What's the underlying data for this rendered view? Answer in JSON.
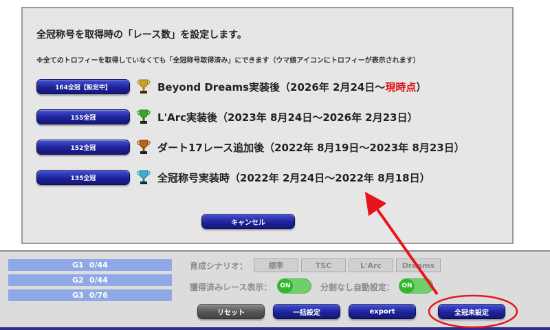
{
  "dialog": {
    "title": "全冠称号を取得時の「レース数」を設定します。",
    "note": "※全てのトロフィーを取得していなくても「全冠称号取得済み」にできます（ウマ娘アイコンにトロフィーが表示されます）",
    "options": [
      {
        "button": "164全冠【設定中】",
        "label": "Beyond Dreams実装後（2026年 2月24日～",
        "label_highlight": "現時点",
        "label_end": "）",
        "trophy_color": "#c9a227"
      },
      {
        "button": "155全冠",
        "label": "L'Arc実装後（2023年 8月24日～2026年 2月23日）",
        "label_highlight": "",
        "label_end": "",
        "trophy_color": "#3aa52e"
      },
      {
        "button": "152全冠",
        "label": "ダート17レース追加後（2022年 8月19日～2023年 8月23日）",
        "label_highlight": "",
        "label_end": "",
        "trophy_color": "#b5651d"
      },
      {
        "button": "135全冠",
        "label": "全冠称号実装時（2022年 2月24日～2022年 8月18日）",
        "label_highlight": "",
        "label_end": "",
        "trophy_color": "#35b3c9"
      }
    ],
    "cancel": "キャンセル"
  },
  "panel": {
    "grades": [
      {
        "name": "G1",
        "value": "0/44"
      },
      {
        "name": "G2",
        "value": "0/44"
      },
      {
        "name": "G3",
        "value": "0/76"
      }
    ],
    "scenario_label": "育成シナリオ：",
    "scenarios": [
      "標準",
      "TSC",
      "L'Arc",
      "Dreams"
    ],
    "acquired_label": "獲得済みレース表示：",
    "auto_label": "分割なし自動設定：",
    "toggle_on": "ON",
    "reset": "リセット",
    "bulk": "一括設定",
    "export": "export",
    "all_crown": "全冠未設定"
  },
  "colors": {
    "button_blue": "#1e2398",
    "highlight_red": "#e01010",
    "annotation_red": "#e8141c",
    "toggle_green": "#2fb82c"
  }
}
